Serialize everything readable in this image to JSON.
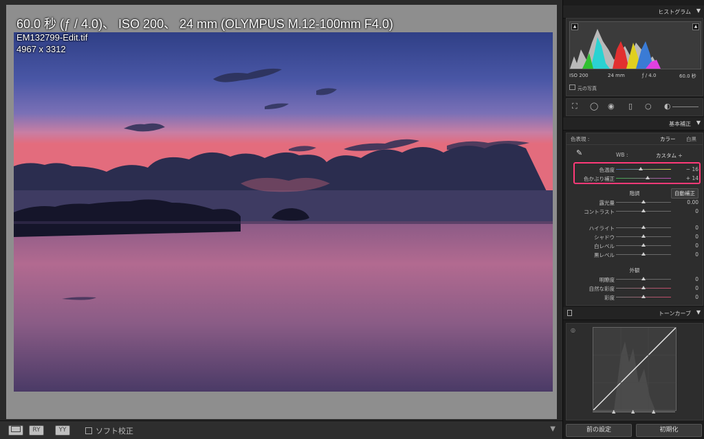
{
  "photo_info": {
    "exposure_line": "60.0 秒 (ƒ / 4.0)、 ISO 200、 24 mm (OLYMPUS M.12-100mm F4.0)",
    "filename": "EM132799-Edit.tif",
    "dimensions": "4967 x 3312"
  },
  "toolbar": {
    "view_ry": "RY",
    "view_yy": "YY",
    "soft_proof_label": "ソフト校正"
  },
  "histogram": {
    "title": "ヒストグラム",
    "iso": "ISO 200",
    "focal": "24 mm",
    "aperture": "ƒ / 4.0",
    "shutter": "60.0 秒",
    "original_photo_label": "元の写真"
  },
  "basic": {
    "title": "基本補正",
    "treatment_label": "色表現 :",
    "treatment_color": "カラー",
    "treatment_bw": "白黒",
    "wb_label": "WB :",
    "wb_value": "カスタム ÷",
    "temp_label": "色温度",
    "temp_value": "− 16",
    "temp_level": 0.45,
    "tint_label": "色かぶり補正",
    "tint_value": "+ 14",
    "tint_level": 0.57,
    "tone_label": "階調",
    "auto_label": "自動補正",
    "exposure_label": "露光量",
    "exposure_value": "0.00",
    "contrast_label": "コントラスト",
    "contrast_value": "0",
    "highlights_label": "ハイライト",
    "highlights_value": "0",
    "shadows_label": "シャドウ",
    "shadows_value": "0",
    "whites_label": "白レベル",
    "whites_value": "0",
    "blacks_label": "黒レベル",
    "blacks_value": "0",
    "presence_label": "外観",
    "clarity_label": "明瞭度",
    "clarity_value": "0",
    "vibrance_label": "自然な彩度",
    "vibrance_value": "0",
    "saturation_label": "彩度",
    "saturation_value": "0"
  },
  "tone_curve": {
    "title": "トーンカーブ"
  },
  "buttons": {
    "previous": "前の設定",
    "reset": "初期化"
  },
  "colors": {
    "highlight_box": "#ff3a78",
    "panel_bg": "#2d2d2d"
  }
}
